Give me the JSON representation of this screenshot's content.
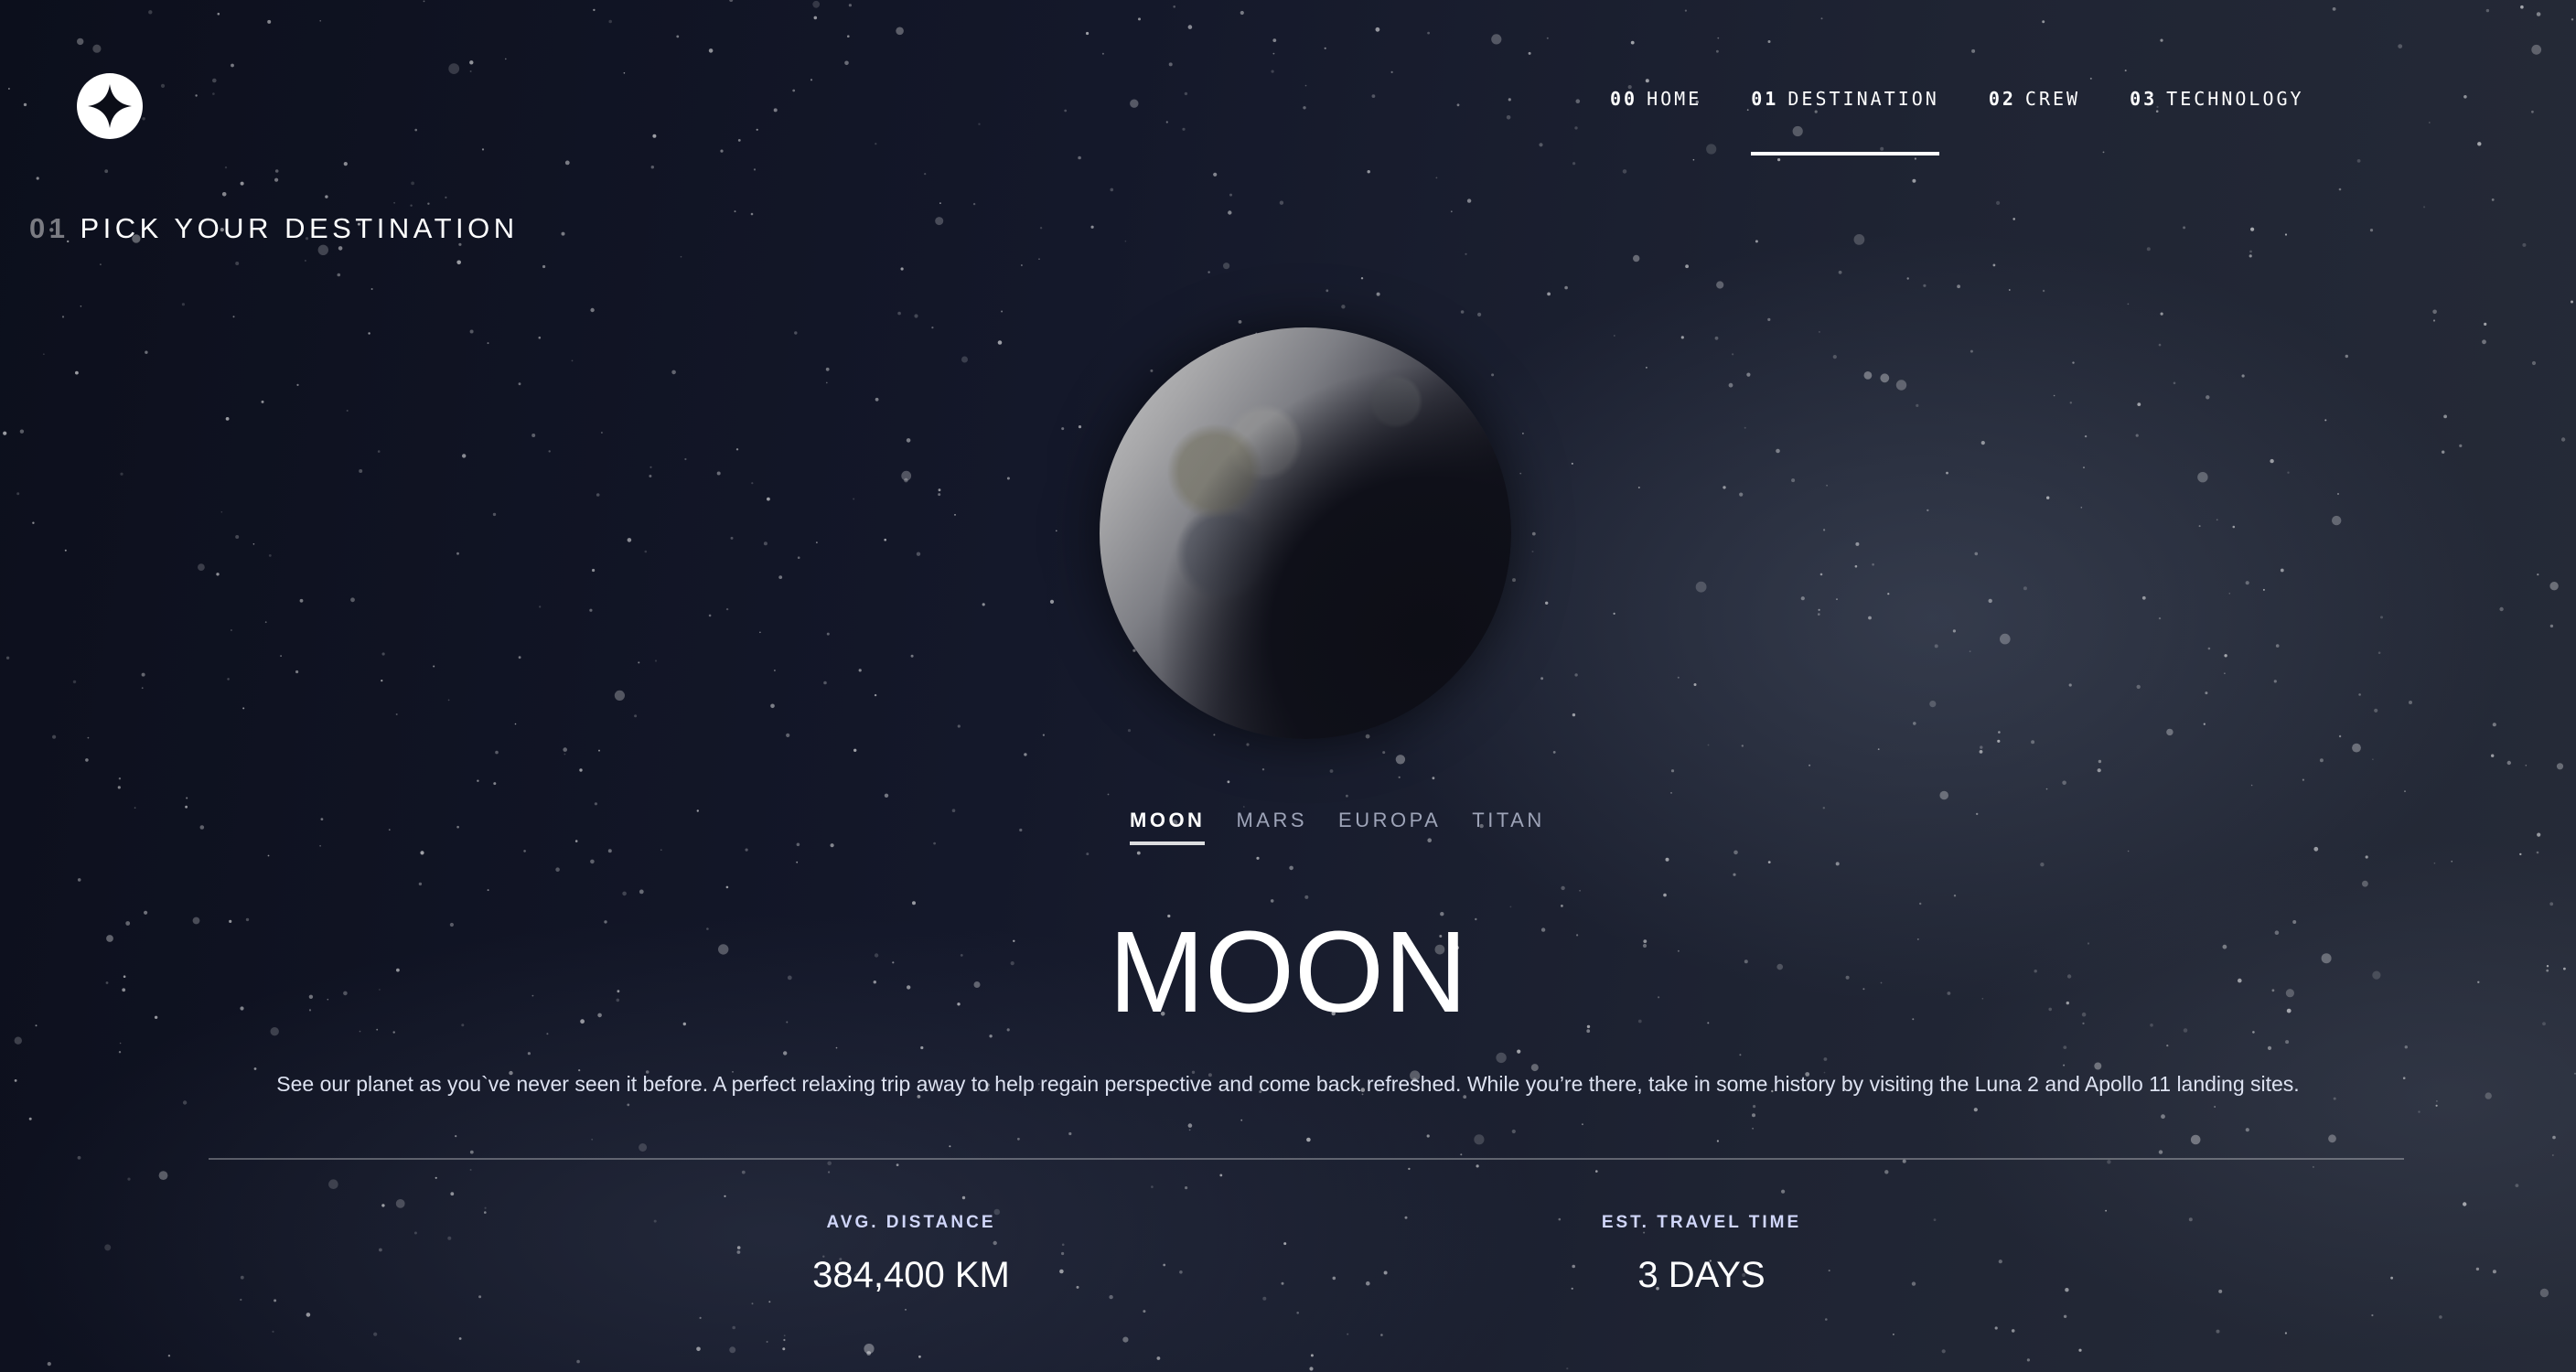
{
  "header": {
    "logo_icon": "star-logo-icon",
    "nav": [
      {
        "num": "00",
        "label": "HOME"
      },
      {
        "num": "01",
        "label": "DESTINATION"
      },
      {
        "num": "02",
        "label": "CREW"
      },
      {
        "num": "03",
        "label": "TECHNOLOGY"
      }
    ],
    "active_nav_index": 1
  },
  "page": {
    "heading_num": "01",
    "heading_text": "PICK YOUR DESTINATION"
  },
  "destination": {
    "image_icon": "moon-image",
    "tabs": [
      "MOON",
      "MARS",
      "EUROPA",
      "TITAN"
    ],
    "active_tab_index": 0,
    "name": "MOON",
    "description": "See our planet as you`ve never seen it before. A perfect relaxing trip away to help regain perspective and come back refreshed. While you’re there, take in some history by visiting the Luna 2 and Apollo 11 landing sites.",
    "stats": {
      "distance_label": "AVG. DISTANCE",
      "distance_value": "384,400 KM",
      "travel_label": "EST. TRAVEL TIME",
      "travel_value": "3 DAYS"
    }
  },
  "colors": {
    "background": "#0b0d17",
    "text_primary": "#ffffff",
    "text_secondary": "#d0d6f9",
    "tab_inactive": "#9ea4b8"
  }
}
